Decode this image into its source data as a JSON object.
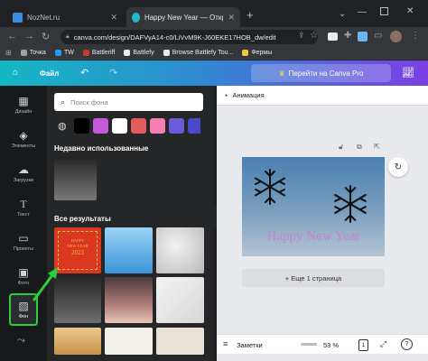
{
  "browser": {
    "tabs": [
      {
        "title": "NozNet.ru",
        "favicon_color": "#3a8dde"
      },
      {
        "title": "Happy New Year — Открытка",
        "favicon_color": "#21b8c8"
      }
    ],
    "new_tab_label": "+",
    "url": "canva.com/design/DAFVyA14-c0/LiVvM9K-J60EKE17HOB_dw/edit",
    "bookmarks": [
      {
        "label": "Точка",
        "color": "#9aa0a6"
      },
      {
        "label": "TW",
        "color": "#1d9bf0"
      },
      {
        "label": "Battleriff",
        "color": "#c23b2f"
      },
      {
        "label": "Battlefy",
        "color": "#e8eaed"
      },
      {
        "label": "Browse Battlefy Tou...",
        "color": "#e8eaed"
      },
      {
        "label": "Фермы",
        "color": "#f5c542"
      }
    ]
  },
  "canva_header": {
    "file_label": "Файл",
    "pro_button": "Перейти на Canva Pro",
    "pro_icon": "crown-icon"
  },
  "sidebar": {
    "items": [
      {
        "label": "Дизайн",
        "icon": "layout-icon"
      },
      {
        "label": "Элементы",
        "icon": "shapes-icon"
      },
      {
        "label": "Загрузки",
        "icon": "upload-cloud-icon"
      },
      {
        "label": "Текст",
        "icon": "text-icon"
      },
      {
        "label": "Проекты",
        "icon": "folder-icon"
      },
      {
        "label": "Фото",
        "icon": "photo-icon"
      },
      {
        "label": "Фон",
        "icon": "background-hatch-icon"
      }
    ],
    "active": "Фон",
    "highlight_color": "#2ad03c"
  },
  "panel": {
    "search_placeholder": "Поиск фона",
    "swatches": [
      "#000000",
      "#c35bd8",
      "#ffffff",
      "#e35b5b",
      "#f47fb0",
      "#6a5bd8",
      "#4a49c9"
    ],
    "recent_title": "Недавно использованные",
    "results_title": "Все результаты",
    "tile_texts": [
      "HAPPY",
      "NEW YEAR",
      "2023"
    ]
  },
  "editor": {
    "animation_label": "Анимация",
    "card_text": "Happy New Year",
    "add_page_label": "+ Еще 1 страница",
    "notes_label": "Заметки",
    "zoom": "53 %",
    "page_count": "1"
  }
}
